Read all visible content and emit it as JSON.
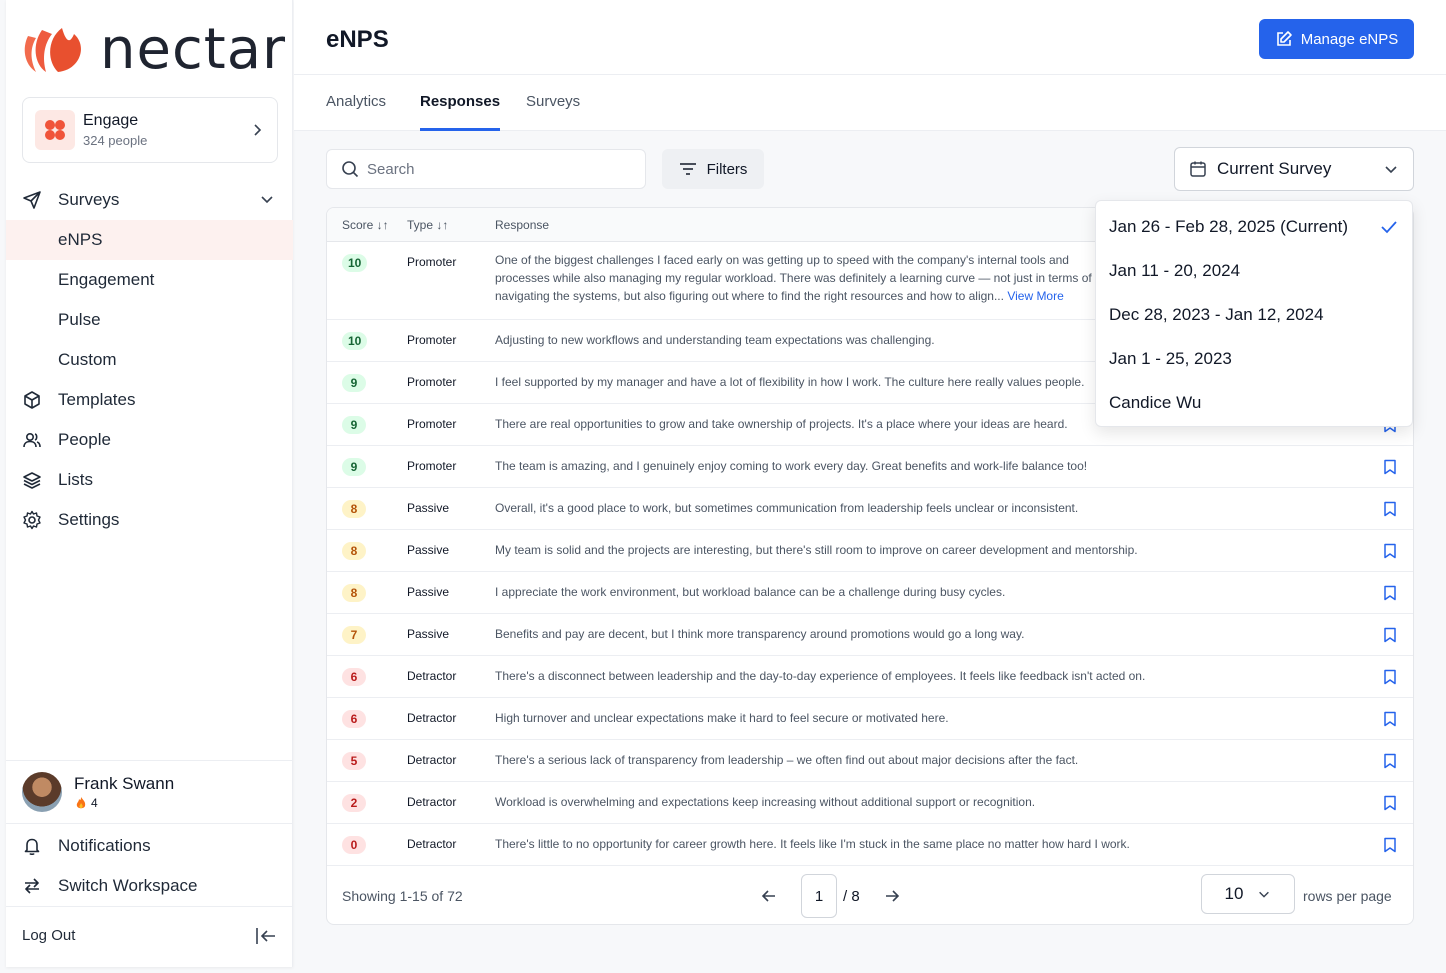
{
  "app": {
    "brand": "nectar"
  },
  "workspace": {
    "name": "Engage",
    "count": "324 people"
  },
  "nav": {
    "surveys": "Surveys",
    "sub": [
      "eNPS",
      "Engagement",
      "Pulse",
      "Custom"
    ],
    "templates": "Templates",
    "people": "People",
    "lists": "Lists",
    "settings": "Settings"
  },
  "user": {
    "name": "Frank Swann",
    "streak": "4"
  },
  "bottom": {
    "notifications": "Notifications",
    "switch": "Switch Workspace",
    "logout": "Log Out"
  },
  "header": {
    "title": "eNPS",
    "manage": "Manage eNPS"
  },
  "tabs": [
    "Analytics",
    "Responses",
    "Surveys"
  ],
  "toolbar": {
    "search_placeholder": "Search",
    "filters": "Filters",
    "survey": "Current Survey"
  },
  "table": {
    "headers": {
      "score": "Score ↓↑",
      "type": "Type ↓↑",
      "response": "Response"
    },
    "view_more": "View More",
    "rows": [
      {
        "score": "10",
        "type": "Promoter",
        "response": "One of the biggest challenges I faced early on was getting up to speed with the company's internal tools and processes while also managing my regular workload. There was definitely a learning curve — not just in terms of navigating the systems, but also figuring out where to find the right resources and how to align...",
        "tone": "green"
      },
      {
        "score": "10",
        "type": "Promoter",
        "response": "Adjusting to new workflows and understanding team expectations was challenging.",
        "tone": "green"
      },
      {
        "score": "9",
        "type": "Promoter",
        "response": "I feel supported by my manager and have a lot of flexibility in how I work. The culture here really values people.",
        "tone": "green"
      },
      {
        "score": "9",
        "type": "Promoter",
        "response": "There are real opportunities to grow and take ownership of projects. It's a place where your ideas are heard.",
        "tone": "green"
      },
      {
        "score": "9",
        "type": "Promoter",
        "response": "The team is amazing, and I genuinely enjoy coming to work every day. Great benefits and work-life balance too!",
        "tone": "green"
      },
      {
        "score": "8",
        "type": "Passive",
        "response": "Overall, it's a good place to work, but sometimes communication from leadership feels unclear or inconsistent.",
        "tone": "amber"
      },
      {
        "score": "8",
        "type": "Passive",
        "response": "My team is solid and the projects are interesting, but there's still room to improve on career development and mentorship.",
        "tone": "amber"
      },
      {
        "score": "8",
        "type": "Passive",
        "response": "I appreciate the work environment, but workload balance can be a challenge during busy cycles.",
        "tone": "amber"
      },
      {
        "score": "7",
        "type": "Passive",
        "response": "Benefits and pay are decent, but I think more transparency around promotions would go a long way.",
        "tone": "amber"
      },
      {
        "score": "6",
        "type": "Detractor",
        "response": "There's a disconnect between leadership and the day-to-day experience of employees. It feels like feedback isn't acted on.",
        "tone": "red"
      },
      {
        "score": "6",
        "type": "Detractor",
        "response": "High turnover and unclear expectations make it hard to feel secure or motivated here.",
        "tone": "red"
      },
      {
        "score": "5",
        "type": "Detractor",
        "response": "There's a serious lack of transparency from leadership – we often find out about major decisions after the fact.",
        "tone": "red"
      },
      {
        "score": "2",
        "type": "Detractor",
        "response": "Workload is overwhelming and expectations keep increasing without additional support or recognition.",
        "tone": "red"
      },
      {
        "score": "0",
        "type": "Detractor",
        "response": "There's little to no opportunity for career growth here. It feels like I'm stuck in the same place no matter how hard I work.",
        "tone": "red"
      }
    ]
  },
  "footer": {
    "showing": "Showing 1-15 of 72",
    "page": "1",
    "total": "/ 8",
    "rows": "10",
    "rows_label": "rows per page"
  },
  "dropdown": {
    "items": [
      "Jan 26 - Feb 28, 2025 (Current)",
      "Jan 11 - 20, 2024",
      "Dec 28, 2023 - Jan 12, 2024",
      "Jan 1 - 25, 2023",
      "Candice Wu"
    ]
  },
  "colors": {
    "accent": "#2563eb",
    "brand": "#ef5b3f"
  }
}
